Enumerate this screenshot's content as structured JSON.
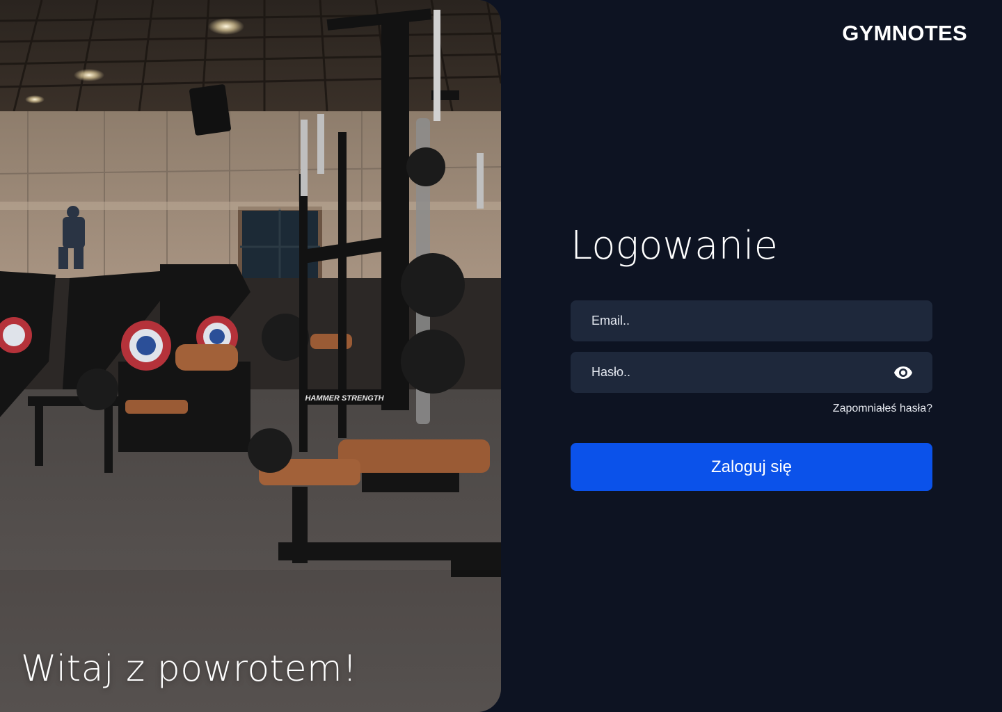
{
  "brand": {
    "name": "GYMNOTES"
  },
  "hero": {
    "image": "gym-interior-photo",
    "caption": "Witaj z powrotem!",
    "equipment_label": "HAMMER STRENGTH"
  },
  "login": {
    "title": "Logowanie",
    "email": {
      "placeholder": "Email..",
      "value": ""
    },
    "password": {
      "placeholder": "Hasło..",
      "value": "",
      "toggle_icon": "eye-icon"
    },
    "forgot_link": "Zapomniałeś hasła?",
    "submit_label": "Zaloguj się"
  },
  "colors": {
    "background": "#0d1322",
    "input_background": "#1e283b",
    "accent": "#0b52ea",
    "text": "#ffffff"
  }
}
